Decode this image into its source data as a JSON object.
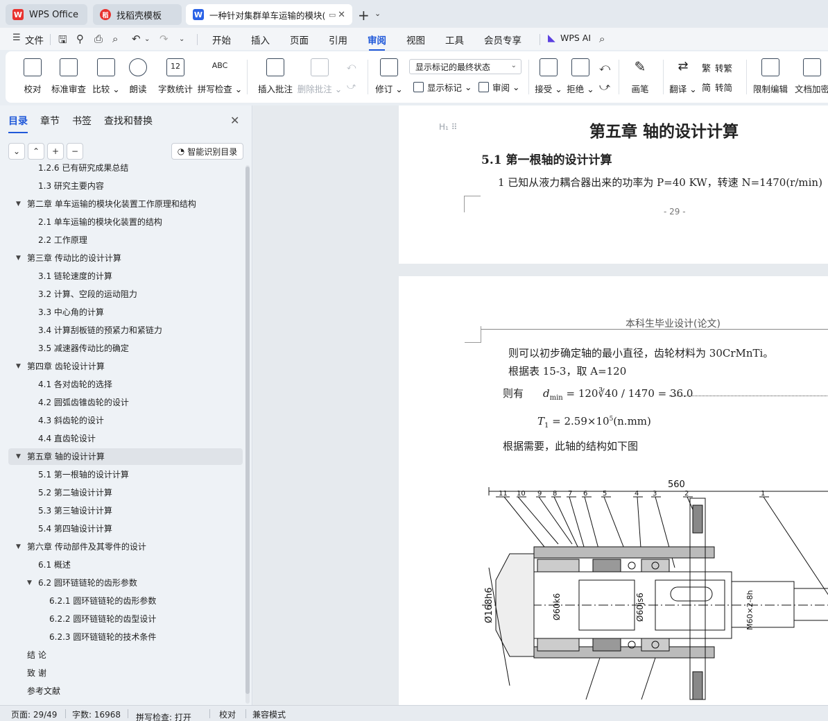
{
  "tabs": [
    {
      "label": "WPS Office",
      "logo": "W"
    },
    {
      "label": "找稻壳模板",
      "logo": "稻"
    },
    {
      "label": "一种针对集群单车运输的模块(",
      "logo": "W"
    }
  ],
  "menu": {
    "file": "文件",
    "items": [
      "开始",
      "插入",
      "页面",
      "引用",
      "审阅",
      "视图",
      "工具",
      "会员专享"
    ],
    "active": "审阅",
    "wps_ai": "WPS AI"
  },
  "ribbon": {
    "proofread": "校对",
    "std_review": "标准审查",
    "compare": "比较",
    "read_aloud": "朗读",
    "word_count": "字数统计",
    "spell_check": "拼写检查",
    "insert_comment": "插入批注",
    "delete_comment": "删除批注",
    "revise": "修订",
    "markup_state": "显示标记的最终状态",
    "show_markup": "显示标记",
    "review": "审阅",
    "accept": "接受",
    "reject": "拒绝",
    "pen": "画笔",
    "translate": "翻译",
    "to_traditional": "转繁",
    "to_simplified": "转简",
    "restrict_edit": "限制编辑",
    "doc_encrypt": "文档加密",
    "word_count_icon_text": "12",
    "spell_icon_text": "ABC"
  },
  "nav": {
    "tabs": [
      "目录",
      "章节",
      "书签",
      "查找和替换"
    ],
    "active_tab": "目录",
    "smart_toc": "智能识别目录",
    "items": [
      {
        "text": "1.2.6  已有研究成果总结",
        "level": 2,
        "arrow": "",
        "partial": true
      },
      {
        "text": "1.3  研究主要内容",
        "level": 2,
        "arrow": ""
      },
      {
        "text": "第二章  单车运输的模块化装置工作原理和结构",
        "level": 1,
        "arrow": "▼"
      },
      {
        "text": "2.1  单车运输的模块化装置的结构",
        "level": 2,
        "arrow": ""
      },
      {
        "text": "2.2  工作原理",
        "level": 2,
        "arrow": ""
      },
      {
        "text": "第三章    传动比的设计计算",
        "level": 1,
        "arrow": "▼"
      },
      {
        "text": "3.1    链轮速度的计算",
        "level": 2,
        "arrow": ""
      },
      {
        "text": "3.2 计算、空段的运动阻力",
        "level": 2,
        "arrow": ""
      },
      {
        "text": "3.3 中心角的计算",
        "level": 2,
        "arrow": ""
      },
      {
        "text": "3.4 计算刮板链的预紧力和紧链力",
        "level": 2,
        "arrow": ""
      },
      {
        "text": "3.5 减速器传动比的确定",
        "level": 2,
        "arrow": ""
      },
      {
        "text": "第四章  齿轮设计计算",
        "level": 1,
        "arrow": "▼"
      },
      {
        "text": "4.1 各对齿轮的选择",
        "level": 2,
        "arrow": ""
      },
      {
        "text": "4.2  圆弧齿锥齿轮的设计",
        "level": 2,
        "arrow": ""
      },
      {
        "text": "4.3  斜齿轮的设计",
        "level": 2,
        "arrow": ""
      },
      {
        "text": "4.4  直齿轮设计",
        "level": 2,
        "arrow": ""
      },
      {
        "text": "第五章  轴的设计计算",
        "level": 1,
        "arrow": "▼",
        "selected": true
      },
      {
        "text": "5.1 第一根轴的设计计算",
        "level": 2,
        "arrow": ""
      },
      {
        "text": "5.2  第二轴设计计算",
        "level": 2,
        "arrow": ""
      },
      {
        "text": "5.3  第三轴设计计算",
        "level": 2,
        "arrow": ""
      },
      {
        "text": "5.4  第四轴设计计算",
        "level": 2,
        "arrow": ""
      },
      {
        "text": "第六章  传动部件及其零件的设计",
        "level": 1,
        "arrow": "▼"
      },
      {
        "text": "6.1  概述",
        "level": 2,
        "arrow": ""
      },
      {
        "text": "6.2  圆环链链轮的齿形参数",
        "level": 2,
        "arrow": "▼"
      },
      {
        "text": "6.2.1  圆环链链轮的齿形参数",
        "level": 3,
        "arrow": ""
      },
      {
        "text": "6.2.2  圆环链链轮的齿型设计",
        "level": 3,
        "arrow": ""
      },
      {
        "text": "6.2.3  圆环链链轮的技术条件",
        "level": 3,
        "arrow": ""
      },
      {
        "text": "结  论",
        "level": 1,
        "arrow": ""
      },
      {
        "text": "致  谢",
        "level": 1,
        "arrow": ""
      },
      {
        "text": "参考文献",
        "level": 1,
        "arrow": ""
      }
    ]
  },
  "doc": {
    "page1": {
      "chapter_title": "第五章  轴的设计计算",
      "heading_marker": "H₁ ⠿",
      "section_title": "5.1 第一根轴的设计计算",
      "line1": "1    已知从液力耦合器出来的功率为   P=40 KW，转速 N=1470(r/min)",
      "page_number": "- 29 -"
    },
    "page2": {
      "header": "本科生毕业设计(论文)",
      "line1": "则可以初步确定轴的最小直径，齿轮材料为 30CrMnTi。",
      "line2": "根据表 15-3，取 A=120",
      "line3_prefix": "则有",
      "formula1": "d",
      "formula1_sub": "min",
      "formula1_rest": " = 120∛40 / 1470 = 36.0",
      "formula2": "T",
      "formula2_sub": "1",
      "formula2_rest": " = 2.59×10",
      "formula2_sup": "5",
      "formula2_unit": "(n.mm)",
      "line4": "根据需要，此轴的结构如下图",
      "drawing": {
        "dim_top": "560",
        "callouts": [
          "11",
          "10",
          "9",
          "8",
          "7",
          "6",
          "5",
          "4",
          "3",
          "2",
          "1"
        ],
        "dim_left": "Ø168h6",
        "dim_mid1": "Ø60k6",
        "dim_mid2": "Ø60js6",
        "dim_right": "M60×2-8h"
      }
    }
  },
  "status": {
    "page": "页面: 29/49",
    "words": "字数: 16968",
    "spell": "拼写检查: 打开",
    "proof": "校对",
    "compat": "兼容模式"
  },
  "colors": {
    "accent": "#1f58d9",
    "wps_red": "#e8322e"
  }
}
